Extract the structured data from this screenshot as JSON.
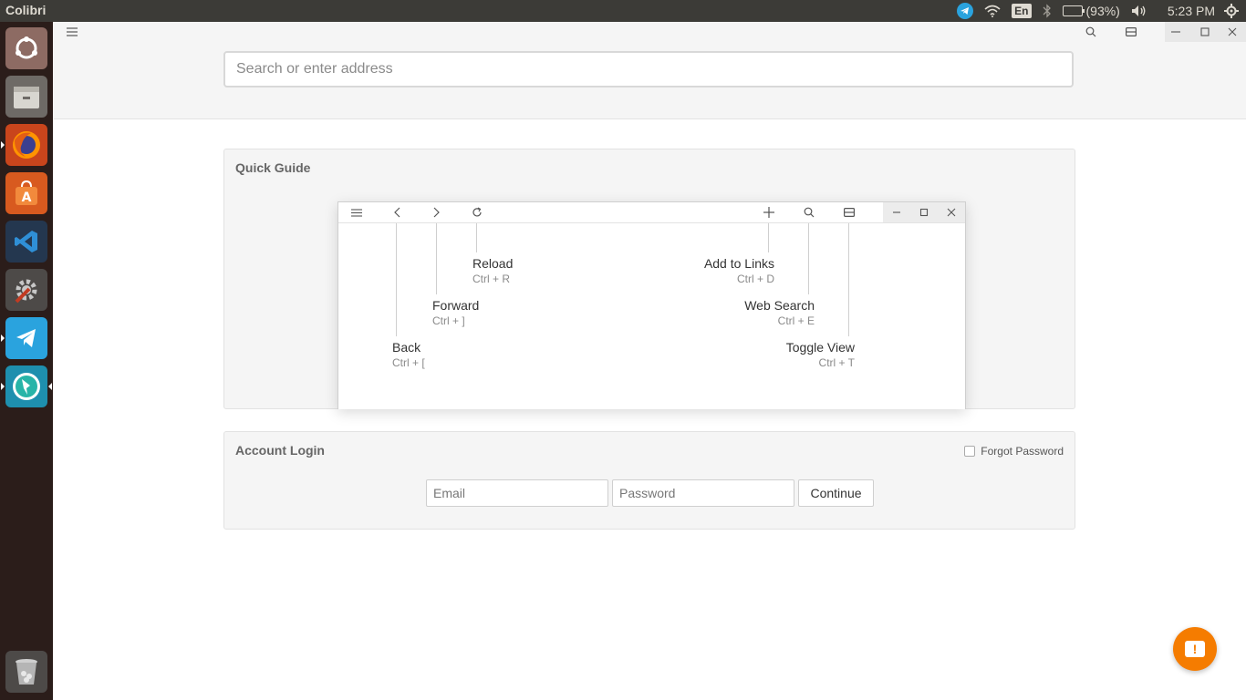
{
  "panel": {
    "app_title": "Colibri",
    "language": "En",
    "battery": "(93%)",
    "time": "5:23 PM",
    "icons": [
      "telegram-icon",
      "wifi-icon",
      "keyboard-language-icon",
      "bluetooth-icon",
      "battery-icon",
      "volume-icon",
      "settings-gear-icon"
    ]
  },
  "launcher": {
    "items": [
      "ubuntu-dash",
      "files",
      "firefox",
      "software-center",
      "vscode",
      "system-settings",
      "telegram",
      "colibri",
      "trash"
    ]
  },
  "header": {
    "menu_icon": "☰",
    "search_placeholder": "Search or enter address"
  },
  "quick_guide": {
    "title": "Quick Guide",
    "items": [
      {
        "label": "Reload",
        "shortcut": "Ctrl + R"
      },
      {
        "label": "Forward",
        "shortcut": "Ctrl + ]"
      },
      {
        "label": "Back",
        "shortcut": "Ctrl + ["
      },
      {
        "label": "Add to Links",
        "shortcut": "Ctrl + D"
      },
      {
        "label": "Web Search",
        "shortcut": "Ctrl + E"
      },
      {
        "label": "Toggle View",
        "shortcut": "Ctrl + T"
      }
    ]
  },
  "login": {
    "title": "Account Login",
    "forgot_label": "Forgot Password",
    "forgot_checked": false,
    "email_placeholder": "Email",
    "password_placeholder": "Password",
    "continue_label": "Continue"
  },
  "colors": {
    "accent": "#f57c00",
    "panel_bg": "#3c3b37",
    "launcher_bg": "#2b1d1a",
    "telegram": "#2aa3de"
  }
}
